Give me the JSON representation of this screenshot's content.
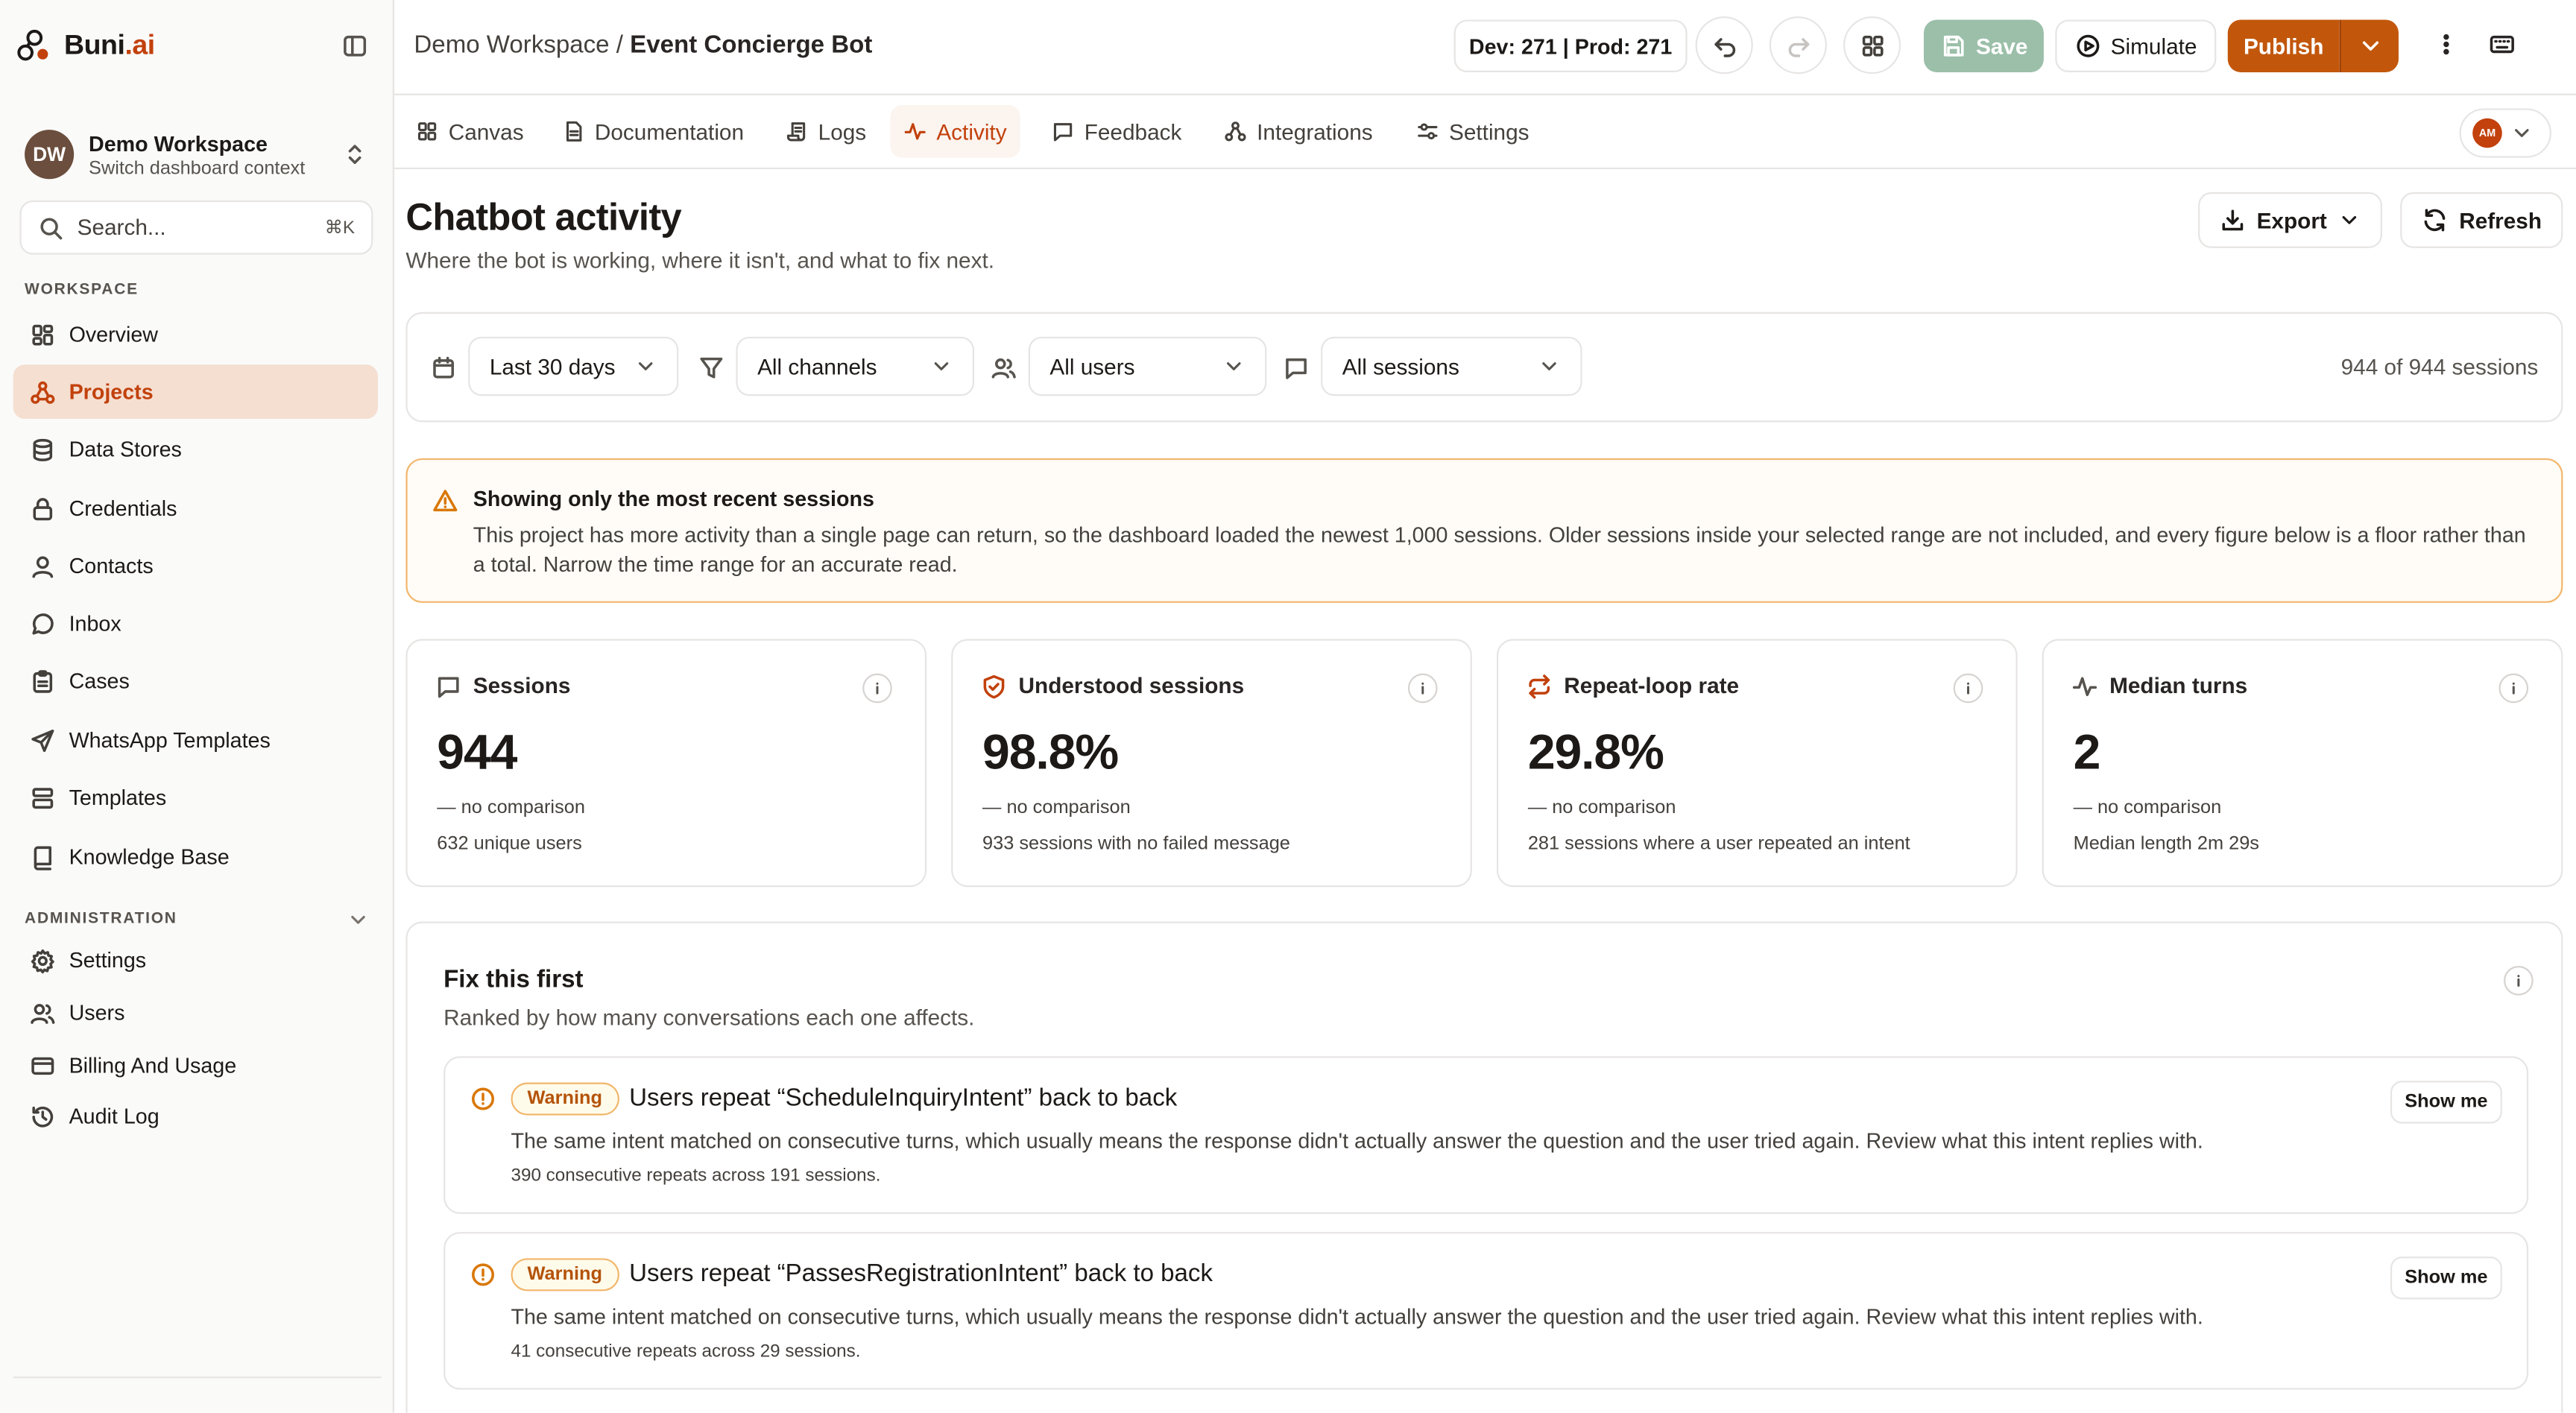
{
  "brand": {
    "name": "Buni",
    "suffix": ".ai"
  },
  "workspace": {
    "initials": "DW",
    "name": "Demo Workspace",
    "subtitle": "Switch dashboard context"
  },
  "search": {
    "placeholder": "Search...",
    "shortcut": "⌘K"
  },
  "sidebar": {
    "workspace_label": "WORKSPACE",
    "items": [
      {
        "label": "Overview",
        "icon": "layout-grid-icon"
      },
      {
        "label": "Projects",
        "icon": "workflow-icon",
        "active": true
      },
      {
        "label": "Data Stores",
        "icon": "database-icon"
      },
      {
        "label": "Credentials",
        "icon": "lock-icon"
      },
      {
        "label": "Contacts",
        "icon": "user-icon"
      },
      {
        "label": "Inbox",
        "icon": "message-circle-icon"
      },
      {
        "label": "Cases",
        "icon": "clipboard-icon"
      },
      {
        "label": "WhatsApp Templates",
        "icon": "send-icon"
      },
      {
        "label": "Templates",
        "icon": "template-icon"
      },
      {
        "label": "Knowledge Base",
        "icon": "book-icon"
      }
    ],
    "admin_label": "ADMINISTRATION",
    "admin_items": [
      {
        "label": "Settings",
        "icon": "gear-icon"
      },
      {
        "label": "Users",
        "icon": "users-icon"
      },
      {
        "label": "Billing And Usage",
        "icon": "credit-card-icon"
      },
      {
        "label": "Audit Log",
        "icon": "history-icon"
      }
    ]
  },
  "header": {
    "breadcrumb_workspace": "Demo Workspace",
    "breadcrumb_sep": " / ",
    "breadcrumb_project": "Event Concierge Bot",
    "env_label": "Dev: 271 | Prod: 271",
    "save_label": "Save",
    "simulate_label": "Simulate",
    "publish_label": "Publish"
  },
  "tabs": [
    {
      "label": "Canvas",
      "icon": "grid-icon"
    },
    {
      "label": "Documentation",
      "icon": "file-text-icon"
    },
    {
      "label": "Logs",
      "icon": "scroll-icon"
    },
    {
      "label": "Activity",
      "icon": "activity-icon",
      "active": true
    },
    {
      "label": "Feedback",
      "icon": "message-square-icon"
    },
    {
      "label": "Integrations",
      "icon": "plug-icon"
    },
    {
      "label": "Settings",
      "icon": "sliders-icon"
    }
  ],
  "user": {
    "initials": "AM"
  },
  "page": {
    "title": "Chatbot activity",
    "subtitle": "Where the bot is working, where it isn't, and what to fix next.",
    "export_label": "Export",
    "refresh_label": "Refresh"
  },
  "filters": {
    "range": "Last 30 days",
    "channels": "All channels",
    "users": "All users",
    "sessions": "All sessions",
    "count_text": "944 of 944 sessions"
  },
  "banner": {
    "title": "Showing only the most recent sessions",
    "body": "This project has more activity than a single page can return, so the dashboard loaded the newest 1,000 sessions. Older sessions inside your selected range are not included, and every figure below is a floor rather than a total. Narrow the time range for an accurate read."
  },
  "kpis": [
    {
      "title": "Sessions",
      "value": "944",
      "comparison": "—  no comparison",
      "detail": "632 unique users",
      "icon": "message-square-icon"
    },
    {
      "title": "Understood sessions",
      "value": "98.8%",
      "comparison": "—  no comparison",
      "detail": "933 sessions with no failed message",
      "icon": "shield-check-icon"
    },
    {
      "title": "Repeat-loop rate",
      "value": "29.8%",
      "comparison": "—  no comparison",
      "detail": "281 sessions where a user repeated an intent",
      "icon": "repeat-icon"
    },
    {
      "title": "Median turns",
      "value": "2",
      "comparison": "—  no comparison",
      "detail": "Median length 2m 29s",
      "icon": "activity-icon"
    }
  ],
  "fix": {
    "title": "Fix this first",
    "subtitle": "Ranked by how many conversations each one affects.",
    "issues": [
      {
        "severity": "Warning",
        "title": "Users repeat “ScheduleInquiryIntent” back to back",
        "description": "The same intent matched on consecutive turns, which usually means the response didn't actually answer the question and the user tried again. Review what this intent replies with.",
        "meta": "390 consecutive repeats across 191 sessions.",
        "action": "Show me"
      },
      {
        "severity": "Warning",
        "title": "Users repeat “PassesRegistrationIntent” back to back",
        "description": "The same intent matched on consecutive turns, which usually means the response didn't actually answer the question and the user tried again. Review what this intent replies with.",
        "meta": "41 consecutive repeats across 29 sessions.",
        "action": "Show me"
      }
    ]
  },
  "colors": {
    "accent": "#c2410c",
    "publish": "#c2570c",
    "save_disabled": "#9bbfa9",
    "warning": "#d97706"
  }
}
